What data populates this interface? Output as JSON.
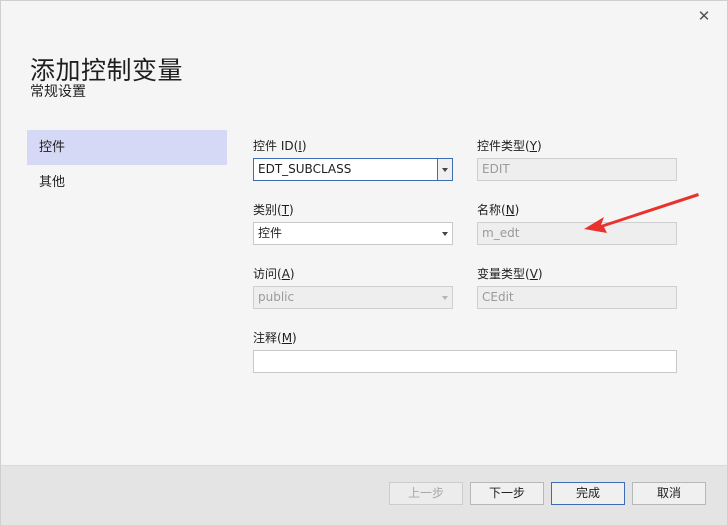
{
  "dialog": {
    "title": "添加控制变量",
    "subtitle": "常规设置",
    "close_glyph": "✕"
  },
  "nav": {
    "items": [
      {
        "label": "控件",
        "active": true
      },
      {
        "label": "其他",
        "active": false
      }
    ]
  },
  "form": {
    "control_id": {
      "label_prefix": "控件 ID(",
      "access_key": "I",
      "label_suffix": ")",
      "value": "EDT_SUBCLASS"
    },
    "control_type": {
      "label_prefix": "控件类型(",
      "access_key": "Y",
      "label_suffix": ")",
      "value": "EDIT"
    },
    "category": {
      "label_prefix": "类别(",
      "access_key": "T",
      "label_suffix": ")",
      "value": "控件"
    },
    "name": {
      "label_prefix": "名称(",
      "access_key": "N",
      "label_suffix": ")",
      "value": "m_edt"
    },
    "access": {
      "label_prefix": "访问(",
      "access_key": "A",
      "label_suffix": ")",
      "value": "public"
    },
    "var_type": {
      "label_prefix": "变量类型(",
      "access_key": "V",
      "label_suffix": ")",
      "value": "CEdit"
    },
    "comment": {
      "label_prefix": "注释(",
      "access_key": "M",
      "label_suffix": ")",
      "value": ""
    }
  },
  "buttons": {
    "prev": "上一步",
    "next": "下一步",
    "finish": "完成",
    "cancel": "取消"
  },
  "annotation": {
    "arrow_color": "#e8322e"
  }
}
